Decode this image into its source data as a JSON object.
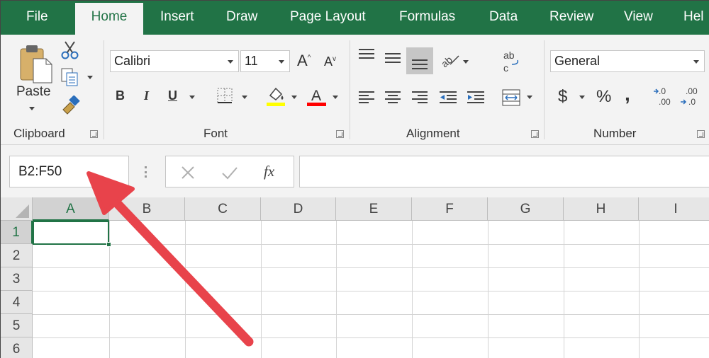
{
  "tabs": [
    {
      "label": "File",
      "active": false
    },
    {
      "label": "Home",
      "active": true
    },
    {
      "label": "Insert",
      "active": false
    },
    {
      "label": "Draw",
      "active": false
    },
    {
      "label": "Page Layout",
      "active": false
    },
    {
      "label": "Formulas",
      "active": false
    },
    {
      "label": "Data",
      "active": false
    },
    {
      "label": "Review",
      "active": false
    },
    {
      "label": "View",
      "active": false
    },
    {
      "label": "Hel",
      "active": false
    }
  ],
  "ribbon": {
    "clipboard": {
      "label": "Clipboard",
      "paste_label": "Paste"
    },
    "font": {
      "label": "Font",
      "font_name": "Calibri",
      "font_size": "11",
      "bold": "B",
      "italic": "I",
      "underline": "U"
    },
    "alignment": {
      "label": "Alignment"
    },
    "number": {
      "label": "Number",
      "format": "General",
      "currency": "$",
      "percent": "%",
      "comma": ","
    }
  },
  "formula_bar": {
    "name_box": "B2:F50",
    "fx_label": "fx",
    "content": ""
  },
  "grid": {
    "columns": [
      "A",
      "B",
      "C",
      "D",
      "E",
      "F",
      "G",
      "H",
      "I"
    ],
    "rows": [
      "1",
      "2",
      "3",
      "4",
      "5",
      "6"
    ],
    "active_cell": "A1"
  },
  "colors": {
    "accent": "#217346",
    "annotation_arrow": "#e8434b",
    "font_color": "#ff0000",
    "highlight_color": "#ffff00"
  }
}
